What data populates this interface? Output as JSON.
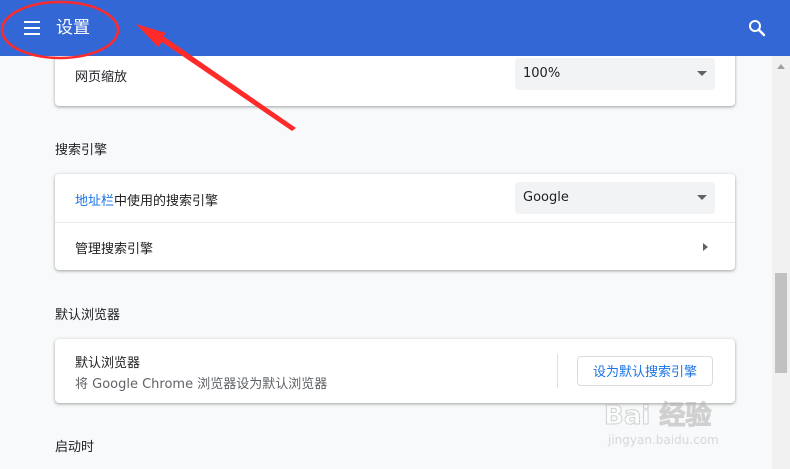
{
  "header": {
    "title": "设置",
    "menu_icon": "hamburger-menu-icon",
    "search_icon": "search-icon",
    "color": "#3367d6"
  },
  "annotation": {
    "color": "#ff2a2a",
    "shapes": [
      "ellipse",
      "arrow"
    ]
  },
  "zoom_card": {
    "label": "网页缩放",
    "value": "100%"
  },
  "search_engine": {
    "section_title": "搜索引擎",
    "row1_link": "地址栏",
    "row1_rest": "中使用的搜索引擎",
    "row1_value": "Google",
    "row2_label": "管理搜索引擎"
  },
  "default_browser": {
    "section_title": "默认浏览器",
    "title": "默认浏览器",
    "subtitle": "将 Google Chrome 浏览器设为默认浏览器",
    "button_label": "设为默认搜索引擎"
  },
  "startup": {
    "section_title": "启动时"
  },
  "watermark": {
    "brand": "Bai 经验",
    "url": "jingyan.baidu.com"
  },
  "colors": {
    "accent": "#1a73e8",
    "background": "#f8f9fa"
  }
}
